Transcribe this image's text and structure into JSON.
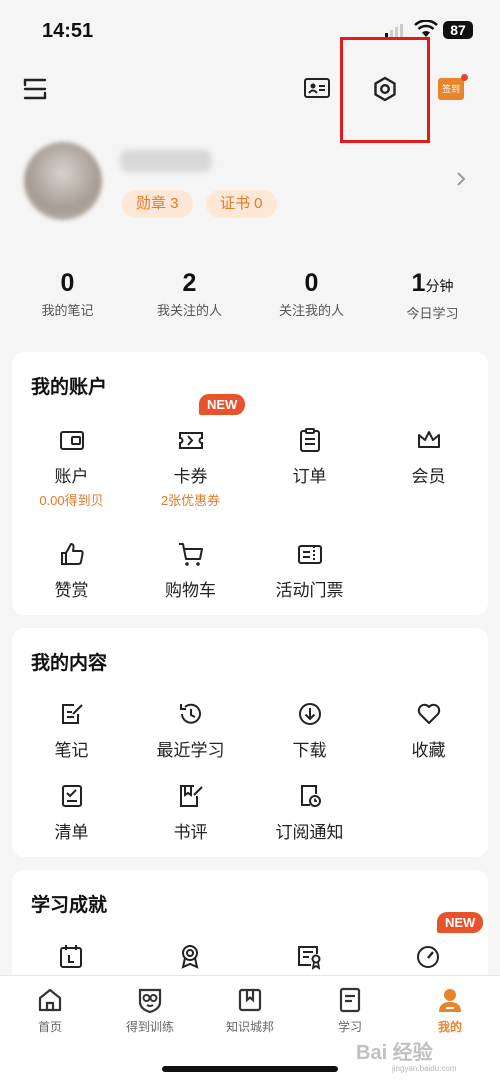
{
  "status_bar": {
    "time": "14:51",
    "battery": "87"
  },
  "top_bar": {
    "signin_label": "签到"
  },
  "profile": {
    "medal_chip": "勋章 3",
    "cert_chip": "证书 0"
  },
  "stats": [
    {
      "value": "0",
      "unit": "",
      "label": "我的笔记"
    },
    {
      "value": "2",
      "unit": "",
      "label": "我关注的人"
    },
    {
      "value": "0",
      "unit": "",
      "label": "关注我的人"
    },
    {
      "value": "1",
      "unit": "分钟",
      "label": "今日学习"
    }
  ],
  "account": {
    "title": "我的账户",
    "new_badge": "NEW",
    "items": [
      {
        "label": "账户",
        "sub": "0.00得到贝",
        "icon": "wallet-icon"
      },
      {
        "label": "卡券",
        "sub": "2张优惠券",
        "icon": "coupon-icon"
      },
      {
        "label": "订单",
        "sub": "",
        "icon": "order-icon"
      },
      {
        "label": "会员",
        "sub": "",
        "icon": "crown-icon"
      },
      {
        "label": "赞赏",
        "sub": "",
        "icon": "thumbs-up-icon"
      },
      {
        "label": "购物车",
        "sub": "",
        "icon": "cart-icon"
      },
      {
        "label": "活动门票",
        "sub": "",
        "icon": "ticket-icon"
      }
    ]
  },
  "content": {
    "title": "我的内容",
    "items": [
      {
        "label": "笔记",
        "icon": "note-icon"
      },
      {
        "label": "最近学习",
        "icon": "history-icon"
      },
      {
        "label": "下载",
        "icon": "download-icon"
      },
      {
        "label": "收藏",
        "icon": "heart-icon"
      },
      {
        "label": "清单",
        "icon": "checklist-icon"
      },
      {
        "label": "书评",
        "icon": "book-review-icon"
      },
      {
        "label": "订阅通知",
        "icon": "subscription-icon"
      }
    ]
  },
  "achievements": {
    "title": "学习成就",
    "new_badge": "NEW"
  },
  "tabbar": {
    "tabs": [
      {
        "label": "首页",
        "icon": "home-icon"
      },
      {
        "label": "得到训练",
        "icon": "training-icon"
      },
      {
        "label": "知识城邦",
        "icon": "bookmark-icon"
      },
      {
        "label": "学习",
        "icon": "study-icon"
      },
      {
        "label": "我的",
        "icon": "profile-icon"
      }
    ]
  },
  "watermark": {
    "text": "Bai 经验",
    "sub": "jingyan.baidu.com"
  },
  "colors": {
    "accent": "#e8842c",
    "highlight": "#e01b1b",
    "badge": "#e8532c"
  }
}
